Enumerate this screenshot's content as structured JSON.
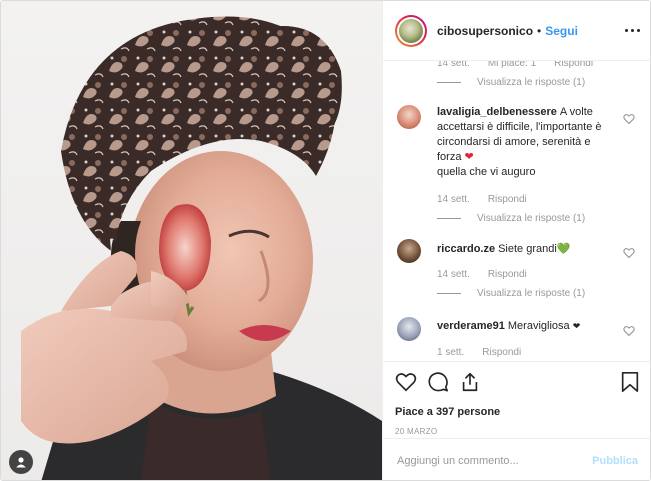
{
  "post": {
    "username": "cibosupersonico",
    "dot": "•",
    "follow_label": "Segui"
  },
  "photo": {
    "alt_subject": "woman-with-paisley-turban-holding-strawberry-slice"
  },
  "top_partial": {
    "time": "14 sett.",
    "likes": "Mi piace: 1",
    "reply": "Rispondi",
    "view_replies": "Visualizza le risposte (1)"
  },
  "comments": [
    {
      "username": "lavaligia_delbenessere",
      "text": "A volte accettarsi è difficile, l'importante è circondarsi di amore, serenità e forza",
      "emoji": "❤",
      "emoji_color": "#e0263a",
      "text_after": " quella che vi auguro",
      "time": "14 sett.",
      "reply": "Rispondi",
      "view_replies": "Visualizza le risposte (1)"
    },
    {
      "username": "riccardo.ze",
      "text": "Siete grandi",
      "emoji": "💚",
      "emoji_color": "#3cb043",
      "text_after": "",
      "time": "14 sett.",
      "reply": "Rispondi",
      "view_replies": "Visualizza le risposte (1)"
    },
    {
      "username": "verderame91",
      "text": "Meravigliosa",
      "emoji": "❤",
      "emoji_color": "#262626",
      "text_after": "",
      "time": "1 sett.",
      "reply": "Rispondi"
    }
  ],
  "actions": {
    "likes_text": "Piace a 397 persone",
    "date": "20 MARZO"
  },
  "comment_box": {
    "placeholder": "Aggiungi un commento...",
    "publish_label": "Pubblica"
  },
  "colors": {
    "accent": "#3897f0",
    "muted": "#999999",
    "publish_disabled": "#b2dffc"
  },
  "icons": [
    "three-dots-icon",
    "heart-icon",
    "comment-icon",
    "share-icon",
    "bookmark-icon",
    "user-tag-icon"
  ]
}
